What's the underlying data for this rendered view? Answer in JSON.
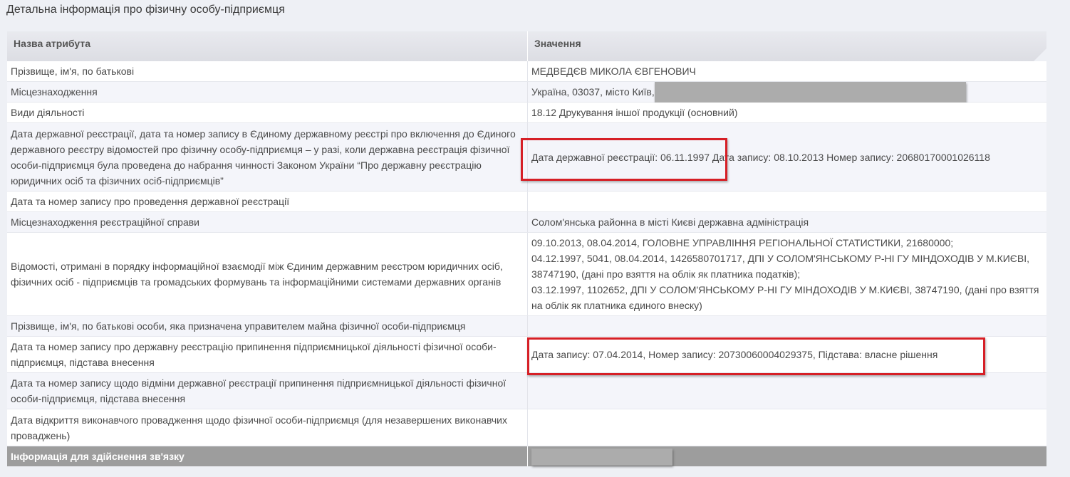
{
  "page_title": "Детальна інформація про фізичну особу-підприємця",
  "table": {
    "headers": {
      "attribute": "Назва атрибута",
      "value": "Значення"
    },
    "rows": [
      {
        "attribute": "Прізвище, ім'я, по батькові",
        "value": "МЕДВЕДЄВ МИКОЛА ЄВГЕНОВИЧ"
      },
      {
        "attribute": "Місцезнаходження",
        "value": "Україна, 03037, місто Київ,"
      },
      {
        "attribute": "Види діяльності",
        "value": "18.12 Друкування іншої продукції (основний)"
      },
      {
        "attribute": "Дата державної реєстрації, дата та номер запису в Єдиному державному реєстрі про включення до Єдиного державного реєстру відомостей про фізичну особу-підприємця – у разі, коли державна реєстрація фізичної особи-підприємця була проведена до набрання чинності Законом України “Про державну реєстрацію юридичних осіб та фізичних осіб-підприємців”",
        "value_parts": [
          "Дата державної реєстрації: 06.11.1997",
          " Дата запису: 08.10.2013 Номер запису: 20680170001026118"
        ]
      },
      {
        "attribute": "Дата та номер запису про проведення державної реєстрації",
        "value": ""
      },
      {
        "attribute": "Місцезнаходження реєстраційної справи",
        "value": "Солом'янська районна в місті Києві державна адміністрація"
      },
      {
        "attribute": "Відомості, отримані в порядку інформаційної взаємодії між Єдиним державним реєстром юридичних осіб, фізичних осіб - підприємців та громадських формувань та інформаційними системами державних органів",
        "value_lines": [
          "09.10.2013, 08.04.2014, ГОЛОВНЕ УПРАВЛІННЯ РЕГІОНАЛЬНОЇ СТАТИСТИКИ, 21680000;",
          "04.12.1997, 5041, 08.04.2014, 1426580701717, ДПІ У СОЛОМ'ЯНСЬКОМУ Р-НІ ГУ МІНДОХОДІВ У М.КИЄВІ, 38747190, (дані про взяття на облік як платника податків);",
          "03.12.1997, 1102652, ДПІ У СОЛОМ'ЯНСЬКОМУ Р-НІ ГУ МІНДОХОДІВ У М.КИЄВІ, 38747190, (дані про взяття на облік як платника єдиного внеску)"
        ]
      },
      {
        "attribute": "Прізвище, ім'я, по батькові особи, яка призначена управителем майна фізичної особи-підприємця",
        "value": ""
      },
      {
        "attribute": "Дата та номер запису про державну реєстрацію припинення підприємницької діяльності фізичної особи-підприємця, підстава внесення",
        "value": "Дата запису: 07.04.2014, Номер запису: 20730060004029375, Підстава: власне рішення"
      },
      {
        "attribute": "Дата та номер запису щодо відміни державної реєстрації припинення підприємницької діяльності фізичної особи-підприємця, підстава внесення",
        "value": ""
      },
      {
        "attribute": "Дата відкриття виконавчого провадження щодо фізичної особи-підприємця (для незавершених виконавчих проваджень)",
        "value": ""
      }
    ],
    "footer": {
      "attribute": "Інформація для здійснення зв'язку"
    }
  },
  "colors": {
    "highlight": "#d61f26",
    "redaction": "#acacac",
    "footer_bg": "#9d9d9d"
  }
}
